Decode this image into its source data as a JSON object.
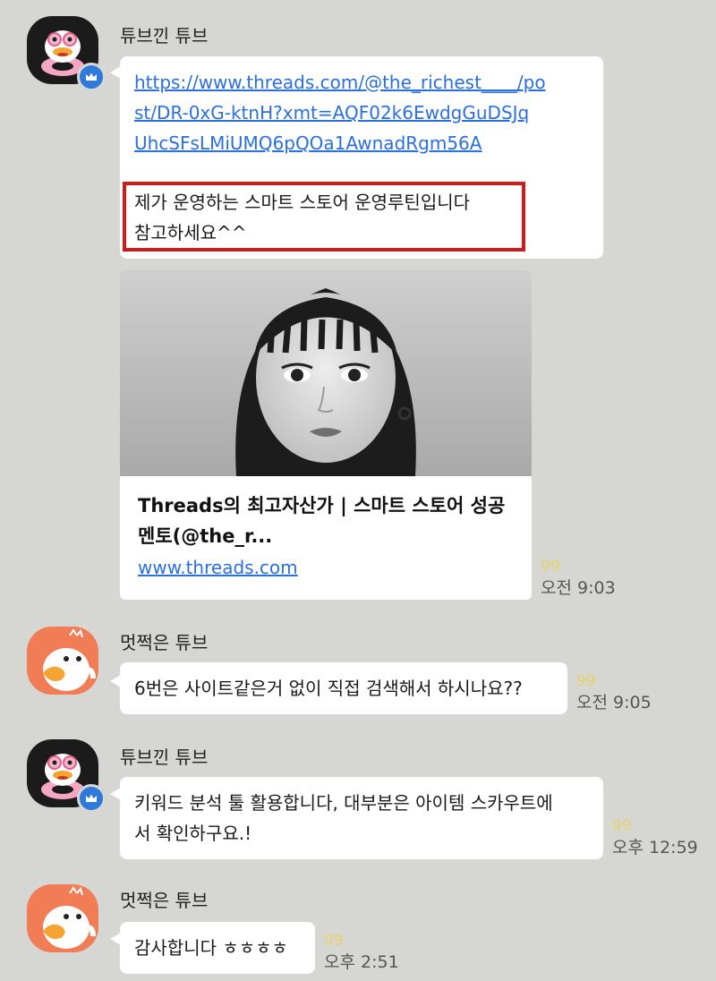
{
  "messages": [
    {
      "sender": "튜브낀 튜브",
      "url_lines": [
        "https://www.threads.com/@the_richest____/po",
        "st/DR-0xG-ktnH?xmt=AQF02k6EwdgGuDSJq",
        "UhcSFsLMiUMQ6pQOa1AwnadRgm56A"
      ],
      "text_lines": [
        "제가 운영하는 스마트 스토어 운영루틴입니다",
        "참고하세요^^"
      ],
      "preview": {
        "title_lines": [
          "Threads의 최고자산가 | 스마트 스토어 성공",
          "멘토(@the_r..."
        ],
        "url": "www.threads.com"
      },
      "unread": "99",
      "time": "오전 9:03"
    },
    {
      "sender": "멋쩍은 튜브",
      "text": "6번은 사이트같은거 없이 직접 검색해서 하시나요??",
      "unread": "99",
      "time": "오전 9:05"
    },
    {
      "sender": "튜브낀 튜브",
      "text_lines": [
        "키워드 분석 툴 활용합니다, 대부분은 아이템 스카우트에",
        "서 확인하구요.!"
      ],
      "unread": "99",
      "time": "오후 12:59"
    },
    {
      "sender": "멋쩍은 튜브",
      "text": "감사합니다 ㅎㅎㅎㅎ",
      "unread": "99",
      "time": "오후 2:51"
    }
  ],
  "icons": {
    "avatar_1": "duck-with-float-ring-avatar",
    "badge": "crown-icon",
    "avatar_2": "embarrassed-duck-avatar",
    "preview_image": "woman-portrait-thumbnail"
  },
  "colors": {
    "background": "#d6d7d3",
    "bubble": "#ffffff",
    "link": "#2a6fe0",
    "highlight": "#d11b1b",
    "unread": "#e6d36b",
    "badge": "#2f7ad8",
    "avatar_orange": "#f07d55"
  }
}
